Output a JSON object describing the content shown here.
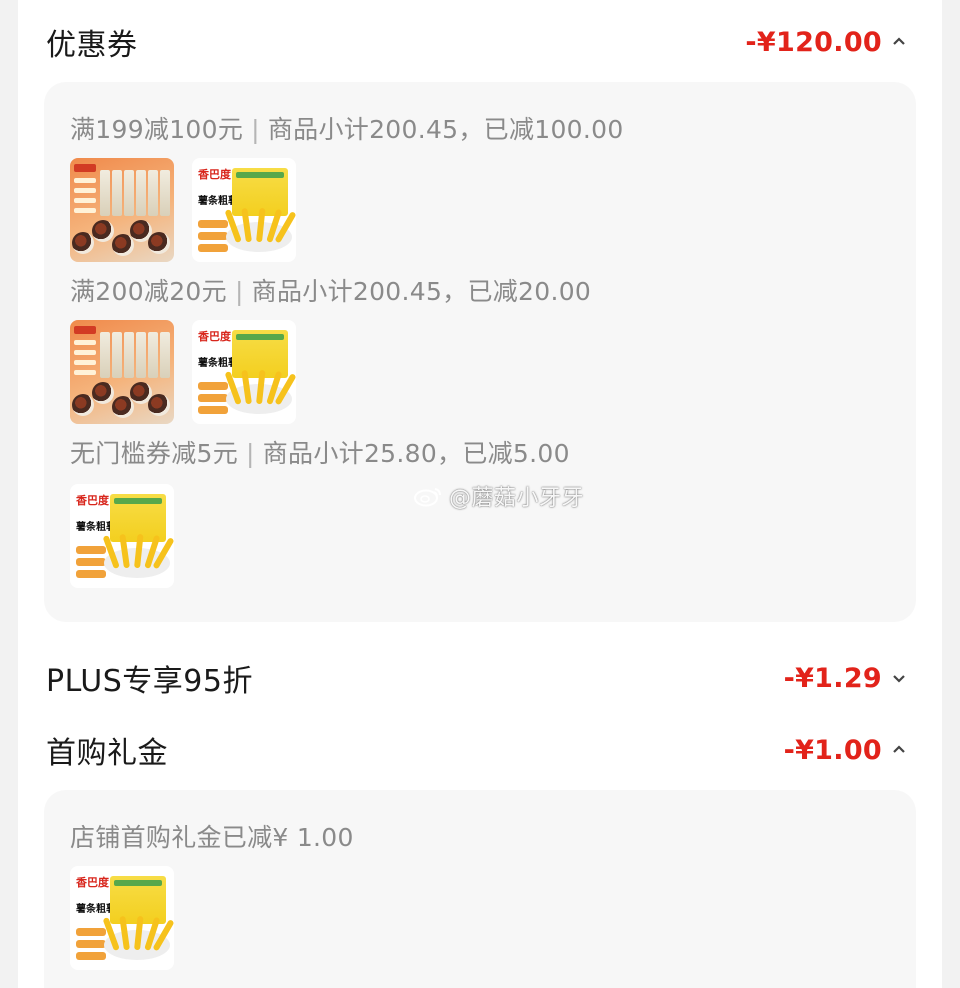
{
  "sections": {
    "coupon": {
      "title": "优惠券",
      "amount": "-¥120.00",
      "expanded": true
    },
    "plus": {
      "title": "PLUS专享95折",
      "amount": "-¥1.29",
      "expanded": false
    },
    "first_buy": {
      "title": "首购礼金",
      "amount": "-¥1.00",
      "expanded": true
    }
  },
  "coupon_rules": [
    {
      "rule": "满199减100元",
      "detail": "商品小计200.45，已减100.00"
    },
    {
      "rule": "满200减20元",
      "detail": "商品小计200.45，已减20.00"
    },
    {
      "rule": "无门槛券减5元",
      "detail": "商品小计25.80，已减5.00"
    }
  ],
  "first_buy_detail": {
    "text": "店铺首购礼金已减¥ 1.00"
  },
  "products": {
    "snack_box": {
      "icon": "snack-gift-box-image"
    },
    "fries": {
      "icon": "french-fries-pack-image",
      "brand": "香巴度",
      "name": "薯条粗薯"
    }
  },
  "watermark": {
    "text": "@蘑菇小牙牙",
    "icon": "weibo-icon"
  },
  "colors": {
    "amount": "#e2231a",
    "panel": "#f7f7f7",
    "rule_text": "#8a8a8a"
  }
}
